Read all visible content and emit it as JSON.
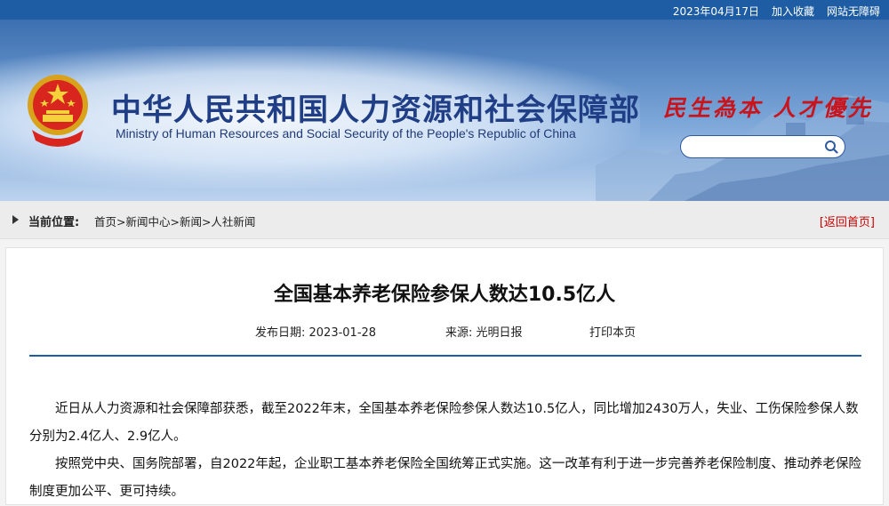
{
  "topbar": {
    "date": "2023年04月17日",
    "favorite": "加入收藏",
    "accessibility": "网站无障碍"
  },
  "header": {
    "title_cn": "中华人民共和国人力资源和社会保障部",
    "title_en": "Ministry of Human Resources and Social Security of the People's Republic of China",
    "slogan": "民生為本 人才優先",
    "search_placeholder": ""
  },
  "breadcrumb": {
    "label": "当前位置:",
    "path": "首页>新闻中心>新闻>人社新闻",
    "back": "[返回首页]"
  },
  "article": {
    "title": "全国基本养老保险参保人数达10.5亿人",
    "publish_date": "发布日期: 2023-01-28",
    "source": "来源: 光明日报",
    "print": "打印本页",
    "paragraphs": [
      "近日从人力资源和社会保障部获悉，截至2022年末，全国基本养老保险参保人数达10.5亿人，同比增加2430万人，失业、工伤保险参保人数分别为2.4亿人、2.9亿人。",
      "按照党中央、国务院部署，自2022年起，企业职工基本养老保险全国统筹正式实施。这一改革有利于进一步完善养老保险制度、推动养老保险制度更加公平、更可持续。"
    ]
  },
  "colors": {
    "topbar": "#1e5da3",
    "title": "#1f3e86",
    "slogan": "#c8141c",
    "rule": "#1e5da3"
  }
}
